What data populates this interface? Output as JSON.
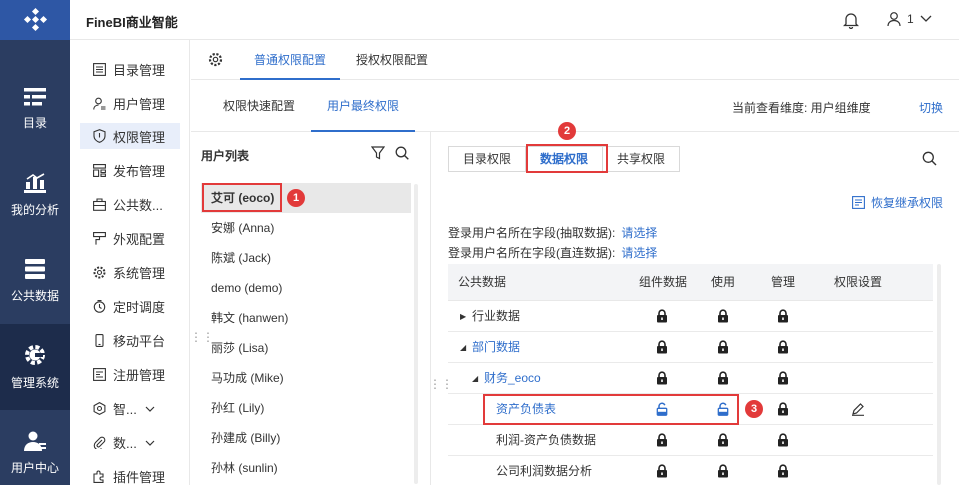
{
  "app": {
    "title": "FineBI商业智能",
    "user_name": "1"
  },
  "leftnav": [
    {
      "label": "目录",
      "icon": "catalog-icon"
    },
    {
      "label": "我的分析",
      "icon": "analysis-icon"
    },
    {
      "label": "公共数据",
      "icon": "database-icon"
    },
    {
      "label": "管理系统",
      "icon": "gear-icon",
      "active": true
    },
    {
      "label": "用户中心",
      "icon": "user-icon"
    }
  ],
  "submenu": [
    {
      "label": "目录管理"
    },
    {
      "label": "用户管理"
    },
    {
      "label": "权限管理",
      "active": true
    },
    {
      "label": "发布管理"
    },
    {
      "label": "公共数..."
    },
    {
      "label": "外观配置"
    },
    {
      "label": "系统管理"
    },
    {
      "label": "定时调度"
    },
    {
      "label": "移动平台"
    },
    {
      "label": "注册管理"
    },
    {
      "label": "智..."
    },
    {
      "label": "数..."
    },
    {
      "label": "插件管理"
    }
  ],
  "tabs_top": {
    "general": "普通权限配置",
    "grant": "授权权限配置"
  },
  "tabs_sub": {
    "quick": "权限快速配置",
    "final": "用户最终权限"
  },
  "dimension": {
    "label": "当前查看维度: 用户组维度",
    "switch": "切换"
  },
  "user_list": {
    "title": "用户列表",
    "users": [
      "艾可 (eoco)",
      "安娜 (Anna)",
      "陈斌 (Jack)",
      "demo (demo)",
      "韩文 (hanwen)",
      "丽莎 (Lisa)",
      "马功成 (Mike)",
      "孙红 (Lily)",
      "孙建成 (Billy)",
      "孙林 (sunlin)"
    ]
  },
  "perm_tabs": {
    "catalog": "目录权限",
    "data": "数据权限",
    "share": "共享权限"
  },
  "restore": "恢复继承权限",
  "fields": {
    "extract_label": "登录用户名所在字段(抽取数据):",
    "direct_label": "登录用户名所在字段(直连数据):",
    "choose": "请选择"
  },
  "table": {
    "headers": {
      "name": "公共数据",
      "component": "组件数据",
      "use": "使用",
      "manage": "管理",
      "settings": "权限设置"
    },
    "rows": [
      {
        "name": "行业数据",
        "expand": "▶"
      },
      {
        "name": "部门数据",
        "expand": "◢"
      },
      {
        "name": "财务_eoco",
        "expand": "◢"
      },
      {
        "name": "资产负债表"
      },
      {
        "name": "利润-资产负债数据"
      },
      {
        "name": "公司利润数据分析"
      }
    ]
  },
  "badges": [
    "1",
    "2",
    "3"
  ],
  "colors": {
    "nav_bg": "#2b3d61",
    "logo_bg": "#2e57a5",
    "accent": "#2f6ecb",
    "highlight": "#e23a3a"
  }
}
